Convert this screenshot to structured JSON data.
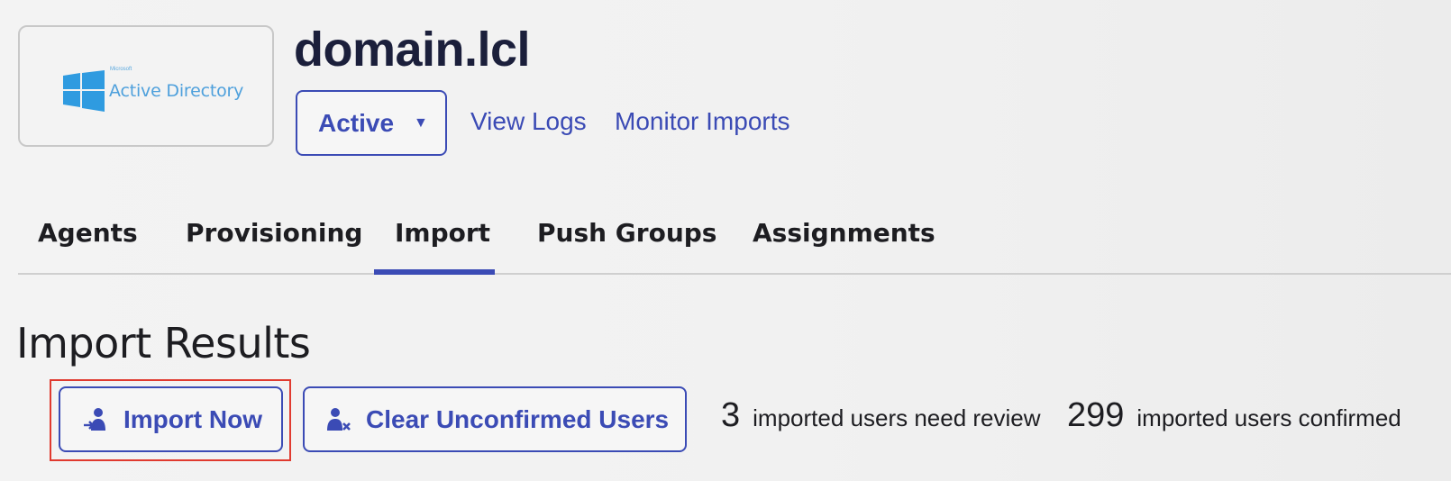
{
  "header": {
    "logo": {
      "icon": "windows-logo-icon",
      "small_text": "Microsoft",
      "product_text": "Active Directory",
      "color": "#4ea0dc"
    },
    "title": "domain.lcl",
    "status_dropdown": {
      "label": "Active",
      "caret": "▼"
    },
    "links": {
      "view_logs": "View Logs",
      "monitor_imports": "Monitor Imports"
    }
  },
  "tabs": [
    {
      "label": "Agents"
    },
    {
      "label": "Provisioning"
    },
    {
      "label": "Import",
      "selected": true
    },
    {
      "label": "Push Groups"
    },
    {
      "label": "Assignments"
    }
  ],
  "section": {
    "title": "Import Results",
    "buttons": {
      "import_now": {
        "label": "Import Now",
        "icon": "import-user-icon",
        "highlighted": true
      },
      "clear_unconfirmed": {
        "label": "Clear Unconfirmed Users",
        "icon": "remove-user-icon"
      }
    },
    "stats": {
      "review_count": "3",
      "review_label": "imported users need review",
      "confirmed_count": "299",
      "confirmed_label": "imported users confirmed"
    }
  },
  "colors": {
    "accent": "#3b4bb5",
    "highlight": "#e03a2f",
    "title": "#1b1f3b"
  }
}
